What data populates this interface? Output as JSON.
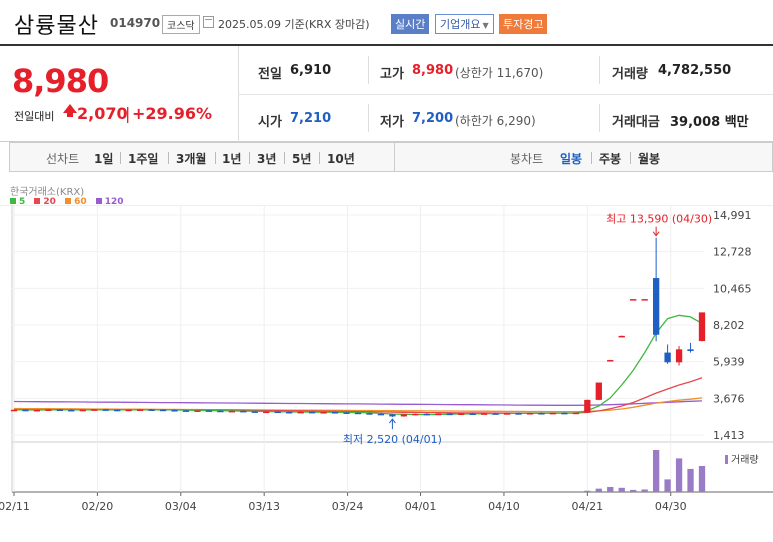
{
  "header": {
    "stock_name": "삼륭물산",
    "stock_code": "014970",
    "market": "코스닥",
    "date_info": "2025.05.09 기준(KRX 장마감)",
    "btn_realtime": "실시간",
    "btn_company": "기업개요",
    "btn_warning": "투자경고"
  },
  "quote": {
    "current_price": "8,980",
    "change_label": "전일대비",
    "change_value": "2,070",
    "change_sep": "|",
    "change_pct": "+29.96%",
    "prev_label": "전일",
    "prev_value": "6,910",
    "high_label": "고가",
    "high_value": "8,980",
    "upper_limit_text": "(상한가 11,670)",
    "volume_label": "거래량",
    "volume_value": "4,782,550",
    "open_label": "시가",
    "open_value": "7,210",
    "low_label": "저가",
    "low_value": "7,200",
    "lower_limit_text": "(하한가 6,290)",
    "amount_label": "거래대금",
    "amount_value": "39,008 백만"
  },
  "tabs": {
    "line_label": "선차트",
    "periods": [
      "1일",
      "1주일",
      "3개월",
      "1년",
      "3년",
      "5년",
      "10년"
    ],
    "candle_label": "봉차트",
    "candle_periods": [
      "일봉",
      "주봉",
      "월봉"
    ],
    "active_candle": "일봉"
  },
  "chart_meta": {
    "source": "한국거래소(KRX)",
    "legend": [
      {
        "name": "5",
        "color": "#3fb83f"
      },
      {
        "name": "20",
        "color": "#e5484d"
      },
      {
        "name": "60",
        "color": "#f0902a"
      },
      {
        "name": "120",
        "color": "#9a5bd1"
      }
    ],
    "high_annotation": "최고 13,590 (04/30)",
    "low_annotation": "최저 2,520 (04/01)",
    "volume_label": "거래량",
    "up_color": "#e5202a",
    "down_color": "#1f5fc4"
  },
  "chart_data": {
    "type": "candlestick",
    "title": "",
    "y_ticks": [
      "14,991",
      "12,728",
      "10,465",
      "8,202",
      "5,939",
      "3,676",
      "1,413"
    ],
    "ylim": [
      1413,
      14991
    ],
    "x_ticks": [
      "02/11",
      "02/20",
      "03/04",
      "03/13",
      "03/24",
      "04/01",
      "04/10",
      "04/21",
      "04/30"
    ],
    "candles": [
      {
        "o": 2950,
        "h": 2990,
        "l": 2920,
        "c": 2970
      },
      {
        "o": 2970,
        "h": 3000,
        "l": 2930,
        "c": 2940
      },
      {
        "o": 2940,
        "h": 2980,
        "l": 2910,
        "c": 2960
      },
      {
        "o": 2960,
        "h": 3010,
        "l": 2940,
        "c": 2990
      },
      {
        "o": 2990,
        "h": 3020,
        "l": 2950,
        "c": 2960
      },
      {
        "o": 2960,
        "h": 2990,
        "l": 2920,
        "c": 2940
      },
      {
        "o": 2940,
        "h": 2980,
        "l": 2910,
        "c": 2970
      },
      {
        "o": 2970,
        "h": 3010,
        "l": 2950,
        "c": 2995
      },
      {
        "o": 2995,
        "h": 3030,
        "l": 2960,
        "c": 2970
      },
      {
        "o": 2970,
        "h": 3000,
        "l": 2930,
        "c": 2950
      },
      {
        "o": 2950,
        "h": 2990,
        "l": 2920,
        "c": 2975
      },
      {
        "o": 2975,
        "h": 3010,
        "l": 2950,
        "c": 2990
      },
      {
        "o": 2990,
        "h": 3020,
        "l": 2960,
        "c": 2975
      },
      {
        "o": 2975,
        "h": 3005,
        "l": 2940,
        "c": 2955
      },
      {
        "o": 2955,
        "h": 2990,
        "l": 2920,
        "c": 2930
      },
      {
        "o": 2930,
        "h": 2960,
        "l": 2890,
        "c": 2905
      },
      {
        "o": 2905,
        "h": 2950,
        "l": 2880,
        "c": 2930
      },
      {
        "o": 2930,
        "h": 2970,
        "l": 2900,
        "c": 2910
      },
      {
        "o": 2910,
        "h": 2940,
        "l": 2870,
        "c": 2885
      },
      {
        "o": 2885,
        "h": 2920,
        "l": 2850,
        "c": 2900
      },
      {
        "o": 2900,
        "h": 2930,
        "l": 2860,
        "c": 2870
      },
      {
        "o": 2870,
        "h": 2900,
        "l": 2830,
        "c": 2845
      },
      {
        "o": 2845,
        "h": 2880,
        "l": 2810,
        "c": 2860
      },
      {
        "o": 2860,
        "h": 2890,
        "l": 2820,
        "c": 2835
      },
      {
        "o": 2835,
        "h": 2870,
        "l": 2800,
        "c": 2820
      },
      {
        "o": 2820,
        "h": 2860,
        "l": 2790,
        "c": 2840
      },
      {
        "o": 2840,
        "h": 2870,
        "l": 2800,
        "c": 2815
      },
      {
        "o": 2815,
        "h": 2850,
        "l": 2780,
        "c": 2830
      },
      {
        "o": 2830,
        "h": 2860,
        "l": 2790,
        "c": 2805
      },
      {
        "o": 2805,
        "h": 2840,
        "l": 2770,
        "c": 2790
      },
      {
        "o": 2790,
        "h": 2820,
        "l": 2740,
        "c": 2760
      },
      {
        "o": 2760,
        "h": 2800,
        "l": 2700,
        "c": 2720
      },
      {
        "o": 2720,
        "h": 2760,
        "l": 2650,
        "c": 2680
      },
      {
        "o": 2680,
        "h": 2720,
        "l": 2520,
        "c": 2560
      },
      {
        "o": 2560,
        "h": 2700,
        "l": 2540,
        "c": 2690
      },
      {
        "o": 2690,
        "h": 2740,
        "l": 2650,
        "c": 2720
      },
      {
        "o": 2720,
        "h": 2760,
        "l": 2680,
        "c": 2700
      },
      {
        "o": 2700,
        "h": 2750,
        "l": 2660,
        "c": 2730
      },
      {
        "o": 2730,
        "h": 2770,
        "l": 2690,
        "c": 2710
      },
      {
        "o": 2710,
        "h": 2760,
        "l": 2670,
        "c": 2740
      },
      {
        "o": 2740,
        "h": 2780,
        "l": 2700,
        "c": 2720
      },
      {
        "o": 2720,
        "h": 2770,
        "l": 2690,
        "c": 2750
      },
      {
        "o": 2750,
        "h": 2790,
        "l": 2710,
        "c": 2735
      },
      {
        "o": 2735,
        "h": 2780,
        "l": 2700,
        "c": 2760
      },
      {
        "o": 2760,
        "h": 2800,
        "l": 2720,
        "c": 2745
      },
      {
        "o": 2745,
        "h": 2790,
        "l": 2710,
        "c": 2770
      },
      {
        "o": 2770,
        "h": 2810,
        "l": 2730,
        "c": 2750
      },
      {
        "o": 2750,
        "h": 2800,
        "l": 2720,
        "c": 2780
      },
      {
        "o": 2780,
        "h": 2820,
        "l": 2740,
        "c": 2760
      },
      {
        "o": 2760,
        "h": 2810,
        "l": 2730,
        "c": 2790
      },
      {
        "o": 2790,
        "h": 3600,
        "l": 2780,
        "c": 3580
      },
      {
        "o": 3580,
        "h": 4650,
        "l": 3560,
        "c": 4650
      },
      {
        "o": 6000,
        "h": 6050,
        "l": 5950,
        "c": 6040
      },
      {
        "o": 7500,
        "h": 7550,
        "l": 7480,
        "c": 7530
      },
      {
        "o": 9800,
        "h": 9800,
        "l": 9800,
        "c": 9800
      },
      {
        "o": 9800,
        "h": 9800,
        "l": 9800,
        "c": 9800
      },
      {
        "o": 11100,
        "h": 13590,
        "l": 7200,
        "c": 7600
      },
      {
        "o": 6500,
        "h": 7000,
        "l": 5800,
        "c": 5900
      },
      {
        "o": 5900,
        "h": 6900,
        "l": 5700,
        "c": 6700
      },
      {
        "o": 6700,
        "h": 7100,
        "l": 6500,
        "c": 6600
      },
      {
        "o": 7210,
        "h": 8980,
        "l": 7200,
        "c": 8980
      }
    ],
    "ma": {
      "5": [
        2960,
        2960,
        2958,
        2962,
        2965,
        2962,
        2960,
        2964,
        2968,
        2966,
        2962,
        2965,
        2972,
        2974,
        2966,
        2950,
        2935,
        2922,
        2910,
        2900,
        2890,
        2880,
        2866,
        2852,
        2840,
        2830,
        2825,
        2822,
        2818,
        2810,
        2795,
        2774,
        2748,
        2712,
        2690,
        2676,
        2674,
        2680,
        2700,
        2712,
        2722,
        2730,
        2736,
        2740,
        2744,
        2750,
        2754,
        2758,
        2762,
        2766,
        2920,
        3200,
        3700,
        4500,
        5400,
        6500,
        7700,
        8600,
        8800,
        8700,
        8300
      ],
      "20": [
        2975,
        2972,
        2970,
        2968,
        2968,
        2967,
        2966,
        2966,
        2967,
        2966,
        2965,
        2964,
        2964,
        2963,
        2961,
        2958,
        2954,
        2950,
        2945,
        2940,
        2935,
        2929,
        2922,
        2915,
        2908,
        2900,
        2892,
        2885,
        2878,
        2870,
        2860,
        2850,
        2838,
        2825,
        2815,
        2806,
        2798,
        2790,
        2784,
        2780,
        2776,
        2774,
        2772,
        2770,
        2768,
        2768,
        2768,
        2768,
        2768,
        2770,
        2812,
        2900,
        3030,
        3200,
        3420,
        3700,
        4000,
        4250,
        4500,
        4700,
        4950
      ],
      "60": [
        3050,
        3045,
        3040,
        3036,
        3032,
        3028,
        3024,
        3020,
        3016,
        3012,
        3008,
        3004,
        3000,
        2996,
        2992,
        2988,
        2984,
        2980,
        2976,
        2972,
        2968,
        2964,
        2960,
        2956,
        2952,
        2948,
        2944,
        2940,
        2936,
        2932,
        2928,
        2924,
        2918,
        2912,
        2908,
        2904,
        2900,
        2896,
        2892,
        2888,
        2884,
        2880,
        2876,
        2872,
        2868,
        2864,
        2862,
        2860,
        2858,
        2856,
        2870,
        2900,
        2950,
        3020,
        3120,
        3250,
        3380,
        3480,
        3560,
        3620,
        3700
      ],
      "120": [
        3480,
        3475,
        3470,
        3465,
        3460,
        3455,
        3450,
        3445,
        3440,
        3435,
        3430,
        3425,
        3420,
        3415,
        3410,
        3405,
        3400,
        3395,
        3390,
        3385,
        3380,
        3375,
        3370,
        3365,
        3360,
        3355,
        3350,
        3345,
        3340,
        3335,
        3330,
        3325,
        3320,
        3315,
        3310,
        3305,
        3300,
        3295,
        3290,
        3285,
        3280,
        3275,
        3270,
        3265,
        3260,
        3255,
        3250,
        3248,
        3246,
        3244,
        3250,
        3265,
        3285,
        3310,
        3340,
        3370,
        3400,
        3430,
        3460,
        3490,
        3520
      ]
    },
    "volume": [
      0.01,
      0.01,
      0.01,
      0.01,
      0.01,
      0.01,
      0.01,
      0.01,
      0.01,
      0.01,
      0.01,
      0.01,
      0.01,
      0.01,
      0.01,
      0.01,
      0.01,
      0.01,
      0.01,
      0.01,
      0.01,
      0.01,
      0.01,
      0.01,
      0.01,
      0.01,
      0.01,
      0.01,
      0.01,
      0.01,
      0.01,
      0.01,
      0.01,
      0.01,
      0.01,
      0.01,
      0.01,
      0.01,
      0.01,
      0.01,
      0.01,
      0.01,
      0.01,
      0.01,
      0.01,
      0.01,
      0.01,
      0.01,
      0.01,
      0.01,
      0.03,
      0.08,
      0.12,
      0.1,
      0.05,
      0.06,
      1.0,
      0.3,
      0.8,
      0.55,
      0.62
    ]
  }
}
